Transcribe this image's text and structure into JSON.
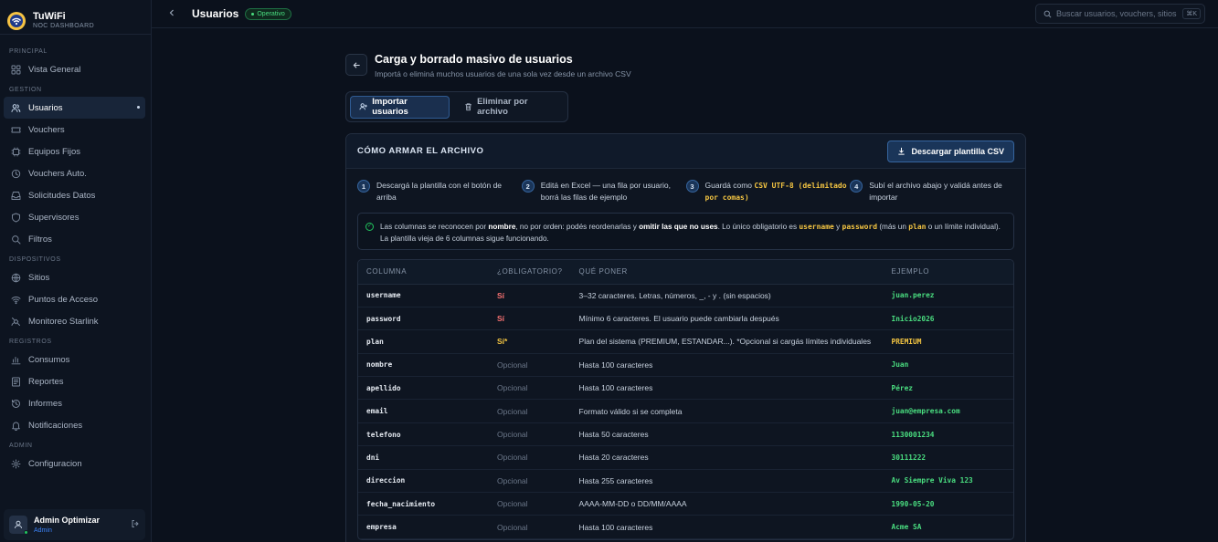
{
  "brand": {
    "name": "TuWiFi",
    "subtitle": "NOC DASHBOARD"
  },
  "sidebar": {
    "sections": [
      {
        "label": "PRINCIPAL",
        "items": [
          {
            "label": "Vista General",
            "icon": "grid-icon"
          }
        ]
      },
      {
        "label": "GESTION",
        "items": [
          {
            "label": "Usuarios",
            "icon": "users-icon",
            "active": true
          },
          {
            "label": "Vouchers",
            "icon": "ticket-icon"
          },
          {
            "label": "Equipos Fijos",
            "icon": "chip-icon"
          },
          {
            "label": "Vouchers Auto.",
            "icon": "clock-icon"
          },
          {
            "label": "Solicitudes Datos",
            "icon": "inbox-icon"
          },
          {
            "label": "Supervisores",
            "icon": "shield-icon"
          },
          {
            "label": "Filtros",
            "icon": "search-icon"
          }
        ]
      },
      {
        "label": "DISPOSITIVOS",
        "items": [
          {
            "label": "Sitios",
            "icon": "globe-icon"
          },
          {
            "label": "Puntos de Acceso",
            "icon": "wifi-icon"
          },
          {
            "label": "Monitoreo Starlink",
            "icon": "satellite-icon"
          }
        ]
      },
      {
        "label": "REGISTROS",
        "items": [
          {
            "label": "Consumos",
            "icon": "chart-icon"
          },
          {
            "label": "Reportes",
            "icon": "report-icon"
          },
          {
            "label": "Informes",
            "icon": "history-icon"
          },
          {
            "label": "Notificaciones",
            "icon": "bell-icon"
          }
        ]
      },
      {
        "label": "ADMIN",
        "items": [
          {
            "label": "Configuracion",
            "icon": "gear-icon"
          }
        ]
      }
    ]
  },
  "user": {
    "name": "Admin Optimizar",
    "role": "Admin"
  },
  "topbar": {
    "title": "Usuarios",
    "status": "Operativo",
    "search_placeholder": "Buscar usuarios, vouchers, sitios",
    "shortcut": "⌘K"
  },
  "page": {
    "title": "Carga y borrado masivo de usuarios",
    "subtitle": "Importá o eliminá muchos usuarios de una sola vez desde un archivo CSV",
    "tabs": [
      {
        "label": "Importar usuarios",
        "active": true
      },
      {
        "label": "Eliminar por archivo",
        "active": false
      }
    ]
  },
  "card": {
    "title": "CÓMO ARMAR EL ARCHIVO",
    "download_label": "Descargar plantilla CSV",
    "steps": [
      {
        "num": "1",
        "text": "Descargá la plantilla con el botón de arriba"
      },
      {
        "num": "2",
        "text": "Editá en Excel — una fila por usuario, borrá las filas de ejemplo"
      },
      {
        "num": "3",
        "text_before": "Guardá como ",
        "code": "CSV UTF-8 (delimitado por comas)"
      },
      {
        "num": "4",
        "text": "Subí el archivo abajo y validá antes de importar"
      }
    ],
    "notice": {
      "t1": "Las columnas se reconocen por ",
      "b1": "nombre",
      "t2": ", no por orden: podés reordenarlas y ",
      "b2": "omitir las que no uses",
      "t3": ". Lo único obligatorio es ",
      "c1": "username",
      "t4": " y ",
      "c2": "password",
      "t5": " (más un ",
      "c3": "plan",
      "t6": " o un límite individual). La plantilla vieja de 6 columnas sigue funcionando."
    },
    "table": {
      "headers": [
        "COLUMNA",
        "¿OBLIGATORIO?",
        "QUÉ PONER",
        "EJEMPLO"
      ],
      "rows": [
        {
          "col": "username",
          "req": "Sí",
          "req_type": "si",
          "what": "3–32 caracteres. Letras, números, _, - y . (sin espacios)",
          "ex": "juan.perez"
        },
        {
          "col": "password",
          "req": "Sí",
          "req_type": "si",
          "what": "Mínimo 6 caracteres. El usuario puede cambiarla después",
          "ex": "Inicio2026"
        },
        {
          "col": "plan",
          "req": "Sí*",
          "req_type": "star",
          "what": "Plan del sistema (PREMIUM, ESTANDAR...). *Opcional si cargás límites individuales",
          "ex": "PREMIUM"
        },
        {
          "col": "nombre",
          "req": "Opcional",
          "req_type": "opt",
          "what": "Hasta 100 caracteres",
          "ex": "Juan"
        },
        {
          "col": "apellido",
          "req": "Opcional",
          "req_type": "opt",
          "what": "Hasta 100 caracteres",
          "ex": "Pérez"
        },
        {
          "col": "email",
          "req": "Opcional",
          "req_type": "opt",
          "what": "Formato válido si se completa",
          "ex": "juan@empresa.com"
        },
        {
          "col": "telefono",
          "req": "Opcional",
          "req_type": "opt",
          "what": "Hasta 50 caracteres",
          "ex": "1130001234"
        },
        {
          "col": "dni",
          "req": "Opcional",
          "req_type": "opt",
          "what": "Hasta 20 caracteres",
          "ex": "30111222"
        },
        {
          "col": "direccion",
          "req": "Opcional",
          "req_type": "opt",
          "what": "Hasta 255 caracteres",
          "ex": "Av Siempre Viva 123"
        },
        {
          "col": "fecha_nacimiento",
          "req": "Opcional",
          "req_type": "opt",
          "what": "AAAA-MM-DD o DD/MM/AAAA",
          "ex": "1990-05-20"
        },
        {
          "col": "empresa",
          "req": "Opcional",
          "req_type": "opt",
          "what": "Hasta 100 caracteres",
          "ex": "Acme SA"
        }
      ]
    }
  },
  "colors": {
    "accent": "#3b82f6",
    "required": "#f87171",
    "warn": "#f4c542",
    "ok": "#4ade80",
    "bg": "#0b111c"
  }
}
